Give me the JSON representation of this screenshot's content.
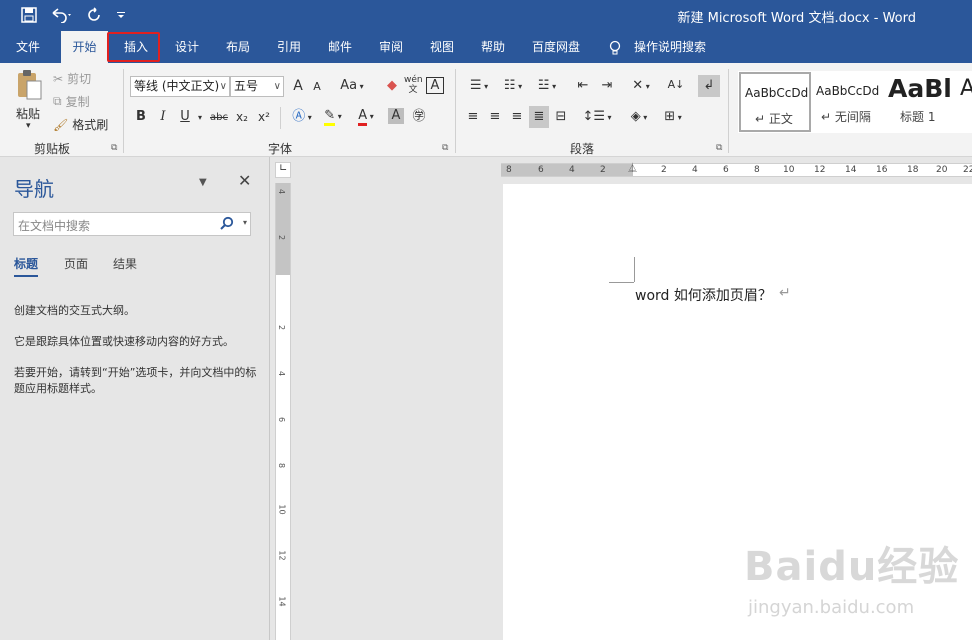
{
  "title_bar": {
    "doc_title": "新建 Microsoft Word 文档.docx  -  Word"
  },
  "menu": {
    "tabs": [
      "文件",
      "开始",
      "插入",
      "设计",
      "布局",
      "引用",
      "邮件",
      "审阅",
      "视图",
      "帮助",
      "百度网盘"
    ],
    "tell_me": "操作说明搜索"
  },
  "ribbon": {
    "clipboard": {
      "paste": "粘贴",
      "cut": "剪切",
      "copy": "复制",
      "format_painter": "格式刷",
      "label": "剪贴板"
    },
    "font": {
      "font_name": "等线 (中文正文)",
      "font_size": "五号",
      "grow": "A",
      "shrink": "A",
      "case": "Aa",
      "clear": "A",
      "phonetic": "wén",
      "border_char": "A",
      "bold": "B",
      "italic": "I",
      "underline": "U",
      "strike": "abc",
      "sub": "x₂",
      "sup": "x²",
      "label": "字体"
    },
    "paragraph": {
      "label": "段落"
    },
    "styles": {
      "s1_preview": "AaBbCcDd",
      "s1_name": "↵ 正文",
      "s2_preview": "AaBbCcDd",
      "s2_name": "↵ 无间隔",
      "s3_preview": "AaBl",
      "s3_name": "标题 1",
      "s4_preview": "A"
    }
  },
  "nav": {
    "title": "导航",
    "search_placeholder": "在文档中搜索",
    "tabs": [
      "标题",
      "页面",
      "结果"
    ],
    "help1": "创建文档的交互式大纲。",
    "help2": "它是跟踪具体位置或快速移动内容的好方式。",
    "help3": "若要开始，请转到“开始”选项卡，并向文档中的标题应用标题样式。"
  },
  "rulers": {
    "h_numbers": [
      "8",
      "6",
      "4",
      "2",
      "2",
      "4",
      "6",
      "8",
      "10",
      "12",
      "14",
      "16",
      "18",
      "20",
      "22"
    ],
    "v_numbers": [
      "4",
      "2",
      "2",
      "4",
      "6",
      "8",
      "10",
      "12",
      "14"
    ]
  },
  "document": {
    "text": "word 如何添加页眉？",
    "para_mark": "↵"
  },
  "watermark": {
    "text": "Baidu经验",
    "url": "jingyan.baidu.com"
  },
  "colors": {
    "accent": "#2b579a",
    "highlight": "#e02020"
  }
}
